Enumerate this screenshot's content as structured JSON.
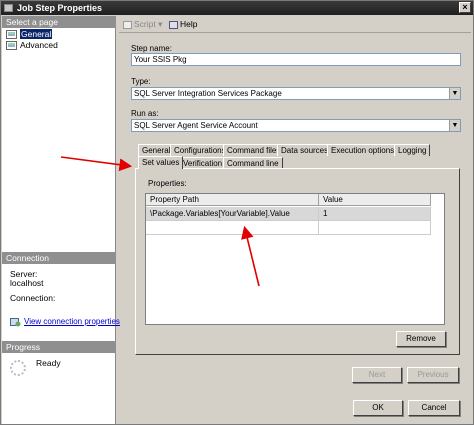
{
  "window": {
    "title": "Job Step Properties",
    "close_glyph": "×"
  },
  "left_panel": {
    "select_page_header": "Select a page",
    "pages": [
      {
        "label": "General",
        "icon": "page-icon",
        "selected": true
      },
      {
        "label": "Advanced",
        "icon": "page-icon",
        "selected": false
      }
    ],
    "connection_header": "Connection",
    "server_label": "Server:",
    "server_value": "localhost",
    "connection_label": "Connection:",
    "connection_value": "",
    "view_connection_link": "View connection properties",
    "progress_header": "Progress",
    "progress_status": "Ready"
  },
  "toolbar": {
    "script_label": "Script",
    "help_label": "Help"
  },
  "form": {
    "step_name_label": "Step name:",
    "step_name_value": "Your SSIS Pkg",
    "type_label": "Type:",
    "type_value": "SQL Server Integration Services Package",
    "run_as_label": "Run as:",
    "run_as_value": "SQL Server Agent Service Account"
  },
  "tabs": {
    "row1": [
      "General",
      "Configurations",
      "Command files",
      "Data sources",
      "Execution options",
      "Logging"
    ],
    "row2": [
      "Set values",
      "Verification",
      "Command line"
    ],
    "active": "Set values"
  },
  "properties": {
    "label": "Properties:",
    "columns": [
      "Property Path",
      "Value"
    ],
    "rows": [
      {
        "path": "\\Package.Variables[YourVariable].Value",
        "value": "1"
      },
      {
        "path": "",
        "value": ""
      }
    ]
  },
  "buttons": {
    "remove": "Remove",
    "next": "Next",
    "previous": "Previous",
    "ok": "OK",
    "cancel": "Cancel"
  },
  "colors": {
    "annotation_arrow": "#e00000",
    "selection": "#0a246a",
    "link": "#0000cc"
  }
}
